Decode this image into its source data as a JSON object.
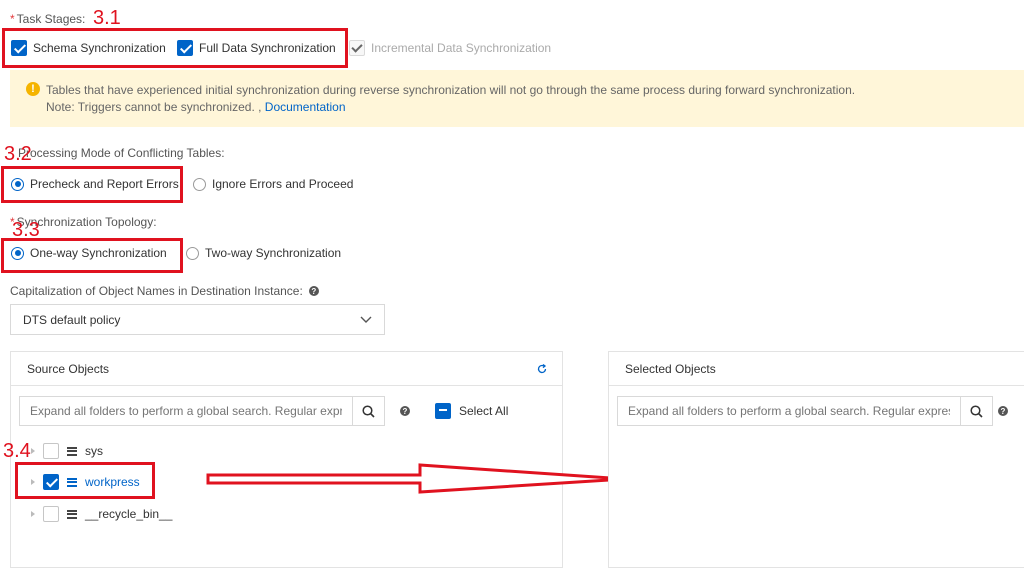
{
  "task_stages": {
    "label": "Task Stages:",
    "required_mark": "*",
    "annotation": "3.1",
    "options": [
      {
        "label": "Schema Synchronization",
        "checked": true
      },
      {
        "label": "Full Data Synchronization",
        "checked": true
      },
      {
        "label": "Incremental Data Synchronization",
        "checked": true,
        "disabled": true
      }
    ]
  },
  "notice": {
    "line1": "Tables that have experienced initial synchronization during reverse synchronization will not go through the same process during forward synchronization.",
    "line2_prefix": "Note: Triggers cannot be synchronized. ,",
    "link": "Documentation",
    "icon": "warning-icon"
  },
  "conflict_mode": {
    "label": "Processing Mode of Conflicting Tables:",
    "annotation": "3.2",
    "options": [
      {
        "label": "Precheck and Report Errors",
        "selected": true
      },
      {
        "label": "Ignore Errors and Proceed",
        "selected": false
      }
    ]
  },
  "topology": {
    "label": "Synchronization Topology:",
    "required_mark": "*",
    "annotation": "3.3",
    "options": [
      {
        "label": "One-way Synchronization",
        "selected": true
      },
      {
        "label": "Two-way Synchronization",
        "selected": false
      }
    ]
  },
  "capitalization": {
    "label": "Capitalization of Object Names in Destination Instance:",
    "value": "DTS default policy"
  },
  "source_panel": {
    "title": "Source Objects",
    "search_placeholder": "Expand all folders to perform a global search. Regular expressions",
    "select_all": "Select All",
    "annotation": "3.4",
    "items": [
      {
        "label": "sys",
        "checked": false
      },
      {
        "label": "workpress",
        "checked": true
      },
      {
        "label": "__recycle_bin__",
        "checked": false
      }
    ]
  },
  "selected_panel": {
    "title": "Selected Objects",
    "search_placeholder": "Expand all folders to perform a global search. Regular expressions"
  },
  "colors": {
    "primary": "#0064c8",
    "annotation_red": "#e0121f",
    "notice_bg": "#fff6d9"
  }
}
